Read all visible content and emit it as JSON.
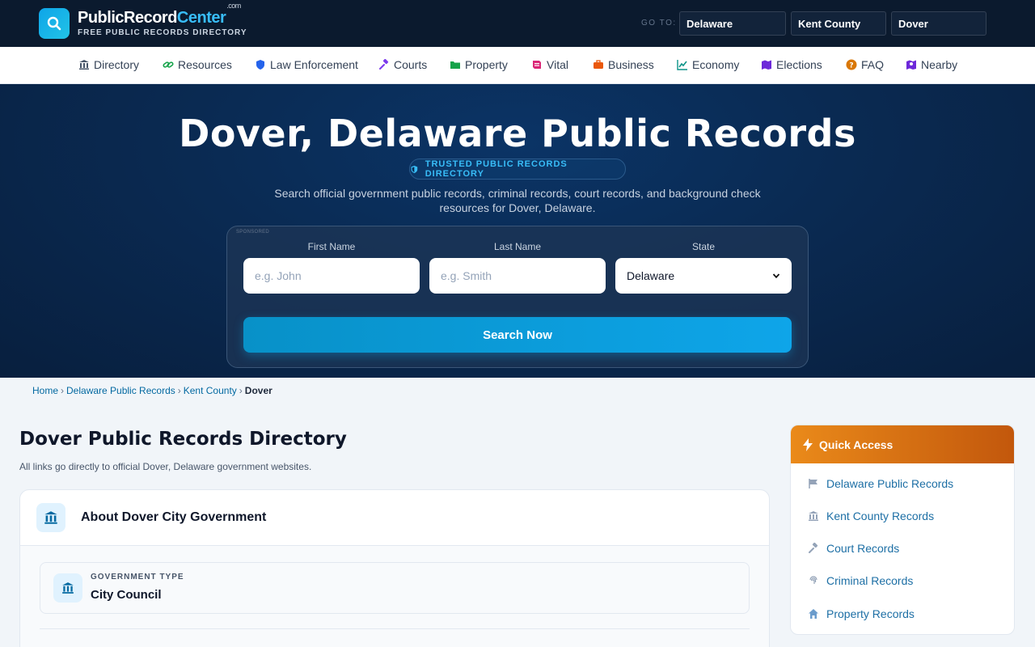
{
  "brand": {
    "name_part1": "PublicRecord",
    "name_part2": "Center",
    "suffix": ".com",
    "tagline": "FREE PUBLIC RECORDS DIRECTORY"
  },
  "goto": {
    "label": "GO TO:",
    "state": "Delaware",
    "county": "Kent County",
    "city": "Dover"
  },
  "nav": {
    "items": [
      {
        "label": "Directory",
        "icon": "bank-icon"
      },
      {
        "label": "Resources",
        "icon": "link-icon"
      },
      {
        "label": "Law Enforcement",
        "icon": "shield-icon"
      },
      {
        "label": "Courts",
        "icon": "gavel-icon"
      },
      {
        "label": "Property",
        "icon": "folder-icon"
      },
      {
        "label": "Vital",
        "icon": "scroll-icon"
      },
      {
        "label": "Business",
        "icon": "briefcase-icon"
      },
      {
        "label": "Economy",
        "icon": "chart-line-icon"
      },
      {
        "label": "Elections",
        "icon": "map-icon"
      },
      {
        "label": "FAQ",
        "icon": "question-icon"
      },
      {
        "label": "Nearby",
        "icon": "map-pin-icon"
      }
    ]
  },
  "hero": {
    "title": "Dover, Delaware Public Records",
    "badge": "TRUSTED PUBLIC RECORDS DIRECTORY",
    "subtitle": "Search official government public records, criminal records, court records, and background check resources for Dover, Delaware.",
    "sponsored": "SPONSORED"
  },
  "search": {
    "first_name_label": "First Name",
    "first_name_placeholder": "e.g. John",
    "last_name_label": "Last Name",
    "last_name_placeholder": "e.g. Smith",
    "state_label": "State",
    "state_value": "Delaware",
    "button": "Search Now"
  },
  "breadcrumb": {
    "home": "Home",
    "state": "Delaware Public Records",
    "county": "Kent County",
    "current": "Dover"
  },
  "main": {
    "title": "Dover Public Records Directory",
    "subtitle": "All links go directly to official Dover, Delaware government websites.",
    "about_title": "About Dover City Government",
    "gov_type_label": "GOVERNMENT TYPE",
    "gov_type_value": "City Council"
  },
  "quick_access": {
    "title": "Quick Access",
    "items": [
      {
        "label": "Delaware Public Records",
        "icon": "flag-icon"
      },
      {
        "label": "Kent County Records",
        "icon": "bank-icon"
      },
      {
        "label": "Court Records",
        "icon": "gavel-icon"
      },
      {
        "label": "Criminal Records",
        "icon": "fingerprint-icon"
      },
      {
        "label": "Property Records",
        "icon": "home-icon"
      }
    ]
  },
  "colors": {
    "topbar": "#0b1a2e",
    "accent": "#0ea5e9",
    "quick_access_header": "#ea8a1a",
    "link": "#1d6fa5"
  }
}
